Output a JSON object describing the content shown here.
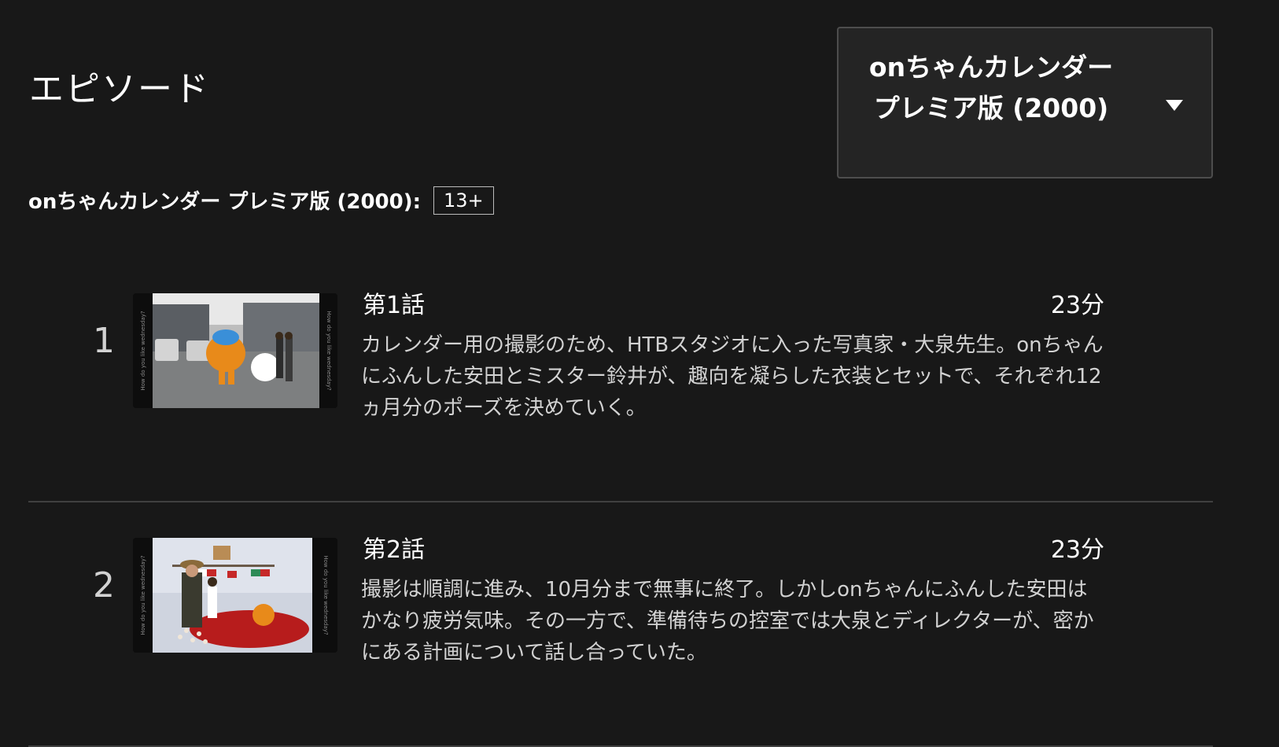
{
  "page": {
    "title": "エピソード"
  },
  "season_select": {
    "selected": "onちゃんカレンダー プレミア版 (2000)"
  },
  "series_info": {
    "title": "onちゃんカレンダー プレミア版 (2000):",
    "maturity_rating": "13+"
  },
  "episodes": [
    {
      "index": "1",
      "title": "第1話",
      "duration": "23分",
      "synopsis": "カレンダー用の撮影のため、HTBスタジオに入った写真家・大泉先生。onちゃんにふんした安田とミスター鈴井が、趣向を凝らした衣装とセットで、それぞれ12ヵ月分のポーズを決めていく。",
      "thumb_caption": "How do you like wednesday?"
    },
    {
      "index": "2",
      "title": "第2話",
      "duration": "23分",
      "synopsis": "撮影は順調に進み、10月分まで無事に終了。しかしonちゃんにふんした安田はかなり疲労気味。その一方で、準備待ちの控室では大泉とディレクターが、密かにある計画について話し合っていた。",
      "thumb_caption": "How do you like wednesday?"
    }
  ],
  "colors": {
    "background": "#181818",
    "divider": "#404040",
    "muted_text": "#d2d2d2",
    "select_border": "#4d4d4d"
  }
}
